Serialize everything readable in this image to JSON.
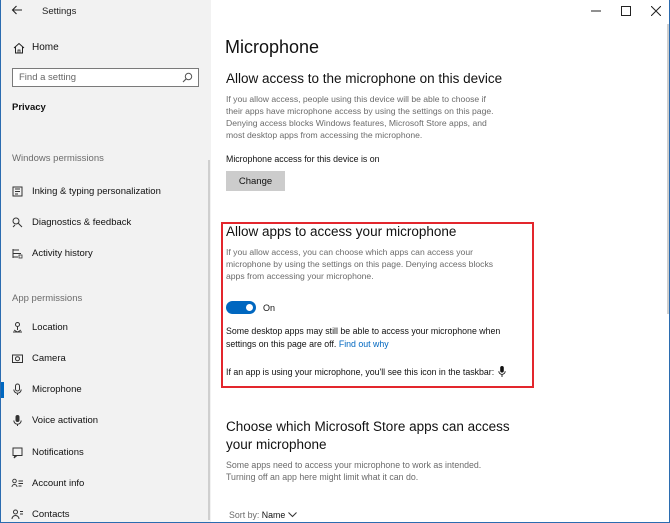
{
  "window": {
    "title": "Settings"
  },
  "sidebar": {
    "home_label": "Home",
    "search_placeholder": "Find a setting",
    "category": "Privacy",
    "windows_permissions_header": "Windows permissions",
    "windows_permissions": [
      {
        "label": "Inking & typing personalization",
        "icon": "inking-icon"
      },
      {
        "label": "Diagnostics & feedback",
        "icon": "diagnostics-icon"
      },
      {
        "label": "Activity history",
        "icon": "activity-history-icon"
      }
    ],
    "app_permissions_header": "App permissions",
    "app_permissions": [
      {
        "label": "Location",
        "icon": "location-icon"
      },
      {
        "label": "Camera",
        "icon": "camera-icon"
      },
      {
        "label": "Microphone",
        "icon": "microphone-icon",
        "active": true
      },
      {
        "label": "Voice activation",
        "icon": "voice-activation-icon"
      },
      {
        "label": "Notifications",
        "icon": "notifications-icon"
      },
      {
        "label": "Account info",
        "icon": "account-info-icon"
      },
      {
        "label": "Contacts",
        "icon": "contacts-icon"
      }
    ]
  },
  "main": {
    "title": "Microphone",
    "device_section": {
      "heading": "Allow access to the microphone on this device",
      "desc_lines": [
        "If you allow access, people using this device will be able to choose if",
        "their apps have microphone access by using the settings on this page.",
        "Denying access blocks Windows features, Microsoft Store apps, and",
        "most desktop apps from accessing the microphone."
      ],
      "status": "Microphone access for this device is on",
      "change_button": "Change"
    },
    "apps_section": {
      "heading": "Allow apps to access your microphone",
      "desc_lines": [
        "If you allow access, you can choose which apps can access your",
        "microphone by using the settings on this page. Denying access blocks",
        "apps from accessing your microphone."
      ],
      "toggle_state": "On",
      "note_line1": "Some desktop apps may still be able to access your microphone when",
      "note_line2": "settings on this page are off.",
      "find_out_why": "Find out why",
      "taskbar_note": "If an app is using your microphone, you'll see this icon in the taskbar:"
    },
    "store_section": {
      "heading_line1": "Choose which Microsoft Store apps can access",
      "heading_line2": "your microphone",
      "desc_lines": [
        "Some apps need to access your microphone to work as intended.",
        "Turning off an app here might limit what it can do."
      ],
      "sort_label": "Sort by:",
      "sort_value": "Name"
    }
  },
  "colors": {
    "accent": "#0067c0",
    "highlight_border": "#e3262d",
    "sidebar_bg": "#f2f2f2"
  }
}
